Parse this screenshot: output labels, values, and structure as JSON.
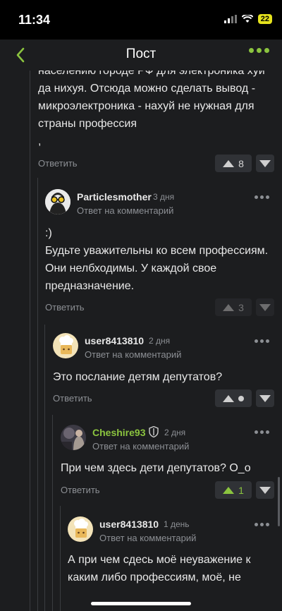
{
  "status": {
    "time": "11:34",
    "battery": "22"
  },
  "header": {
    "title": "Пост"
  },
  "top_comment": {
    "lines": [
      "населению городе РФ для электроника хуй",
      "да нихуя. Отсюда можно сделать вывод -",
      "микроэлектроника - нахуй не нужная для",
      "страны профессия",
      ","
    ],
    "reply_label": "Ответить",
    "score": "8"
  },
  "comments": [
    {
      "username": "Particlesmother",
      "date": "3 дня",
      "subtitle": "Ответ на комментарий",
      "lines": [
        ":)",
        "Будьте уважительны ко всем профессиям.",
        "Они нелбходимы. У каждой свое",
        "предназначение."
      ],
      "reply_label": "Ответить",
      "score": "3"
    },
    {
      "username": "user8413810",
      "date": "2 дня",
      "subtitle": "Ответ на комментарий",
      "lines": [
        "Это послание детям депутатов?"
      ],
      "reply_label": "Ответить",
      "score": ""
    },
    {
      "username": "Cheshire93",
      "date": "2 дня",
      "subtitle": "Ответ на комментарий",
      "lines": [
        "При чем здесь дети депутатов? O_o"
      ],
      "reply_label": "Ответить",
      "score": "1"
    },
    {
      "username": "user8413810",
      "date": "1 день",
      "subtitle": "Ответ на комментарий",
      "lines": [
        "А при чем сдесь моё неуважение к",
        "каким либо профессиям, моё, не"
      ]
    }
  ],
  "colors": {
    "accent": "#8bc43f",
    "background": "#1c1d1f",
    "muted": "#8c8f94"
  }
}
